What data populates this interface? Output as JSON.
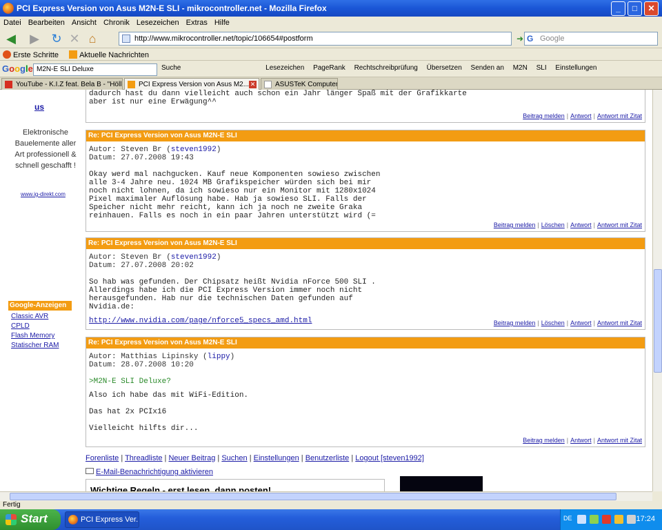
{
  "window": {
    "title": "PCI Express Version von Asus M2N-E SLI - mikrocontroller.net - Mozilla Firefox",
    "minimize": "_",
    "maximize": "□",
    "close": "✕"
  },
  "menu": [
    "Datei",
    "Bearbeiten",
    "Ansicht",
    "Chronik",
    "Lesezeichen",
    "Extras",
    "Hilfe"
  ],
  "nav": {
    "back_icon": "back-arrow-icon",
    "url": "http://www.mikrocontroller.net/topic/106654#postform",
    "search_placeholder": "Google"
  },
  "bookmarks": [
    "Erste Schritte",
    "Aktuelle Nachrichten"
  ],
  "google_toolbar": {
    "logo": "Google",
    "query": "M2N-E SLI Deluxe",
    "items": [
      "Suche",
      "Lesezeichen",
      "PageRank",
      "Rechtschreibprüfung",
      "Übersetzen",
      "Senden an",
      "M2N",
      "SLI",
      "Einstellungen"
    ]
  },
  "tabs": [
    {
      "label": "YouTube - K.I.Z feat. Bela B - \"Hölle\"...",
      "active": false
    },
    {
      "label": "PCI Express Version von Asus M2...",
      "active": true
    },
    {
      "label": "ASUSTeK Computer Inc.",
      "active": false
    }
  ],
  "sidebar": {
    "us_link": "us",
    "ad_text": "Elektronische Bauelemente aller Art professionell & schnell geschafft !",
    "ad_link": "www.ig-direkt.com",
    "google_ads_heading": "Google-Anzeigen",
    "google_ads": [
      "Classic AVR",
      "CPLD",
      "Flash Memory",
      "Statischer RAM"
    ]
  },
  "prev_post": {
    "body": "dadurch hast du dann vielleicht auch schon ein Jahr länger Spaß mit der Grafikkarte\naber ist nur eine Erwägung^^",
    "actions": [
      "Beitrag melden",
      "Antwort",
      "Antwort mit Zitat"
    ]
  },
  "posts": [
    {
      "title": "Re: PCI Express Version von Asus M2N-E SLI",
      "author_label": "Autor: Steven Br",
      "author_nick": "steven1992",
      "date": "Datum: 27.07.2008 19:43",
      "body": "Okay werd mal nachgucken. Kauf neue Komponenten sowieso zwischen alle 3-4 Jahre neu. 1024 MB Grafikspeicher würden sich bei mir noch nicht lohnen, da ich sowieso nur ein Monitor mit 1280x1024 Pixel maximaler Auflösung habe. Hab ja sowieso SLI. Falls der Speicher nicht mehr reicht, kann ich ja noch ne zweite Graka reinhauen. Falls es noch in ein paar Jahren unterstützt wird (=",
      "actions": [
        "Beitrag melden",
        "Löschen",
        "Antwort",
        "Antwort mit Zitat"
      ]
    },
    {
      "title": "Re: PCI Express Version von Asus M2N-E SLI",
      "author_label": "Autor: Steven Br",
      "author_nick": "steven1992",
      "date": "Datum: 27.07.2008 20:02",
      "body": "So hab was gefunden. Der Chipsatz heißt Nvidia nForce 500 SLI . Allerdings habe ich die PCI Express Version immer noch nicht herausgefunden. Hab nur die technischen Daten gefunden auf Nvidia.de:",
      "link": "http://www.nvidia.com/page/nforce5_specs_amd.html",
      "actions": [
        "Beitrag melden",
        "Löschen",
        "Antwort",
        "Antwort mit Zitat"
      ]
    },
    {
      "title": "Re: PCI Express Version von Asus M2N-E SLI",
      "author_label": "Autor: Matthias Lipinsky",
      "author_nick": "lippy",
      "date": "Datum: 28.07.2008 10:20",
      "quote": ">M2N-E SLI Deluxe?",
      "body": "Also ich habe das mit WiFi-Edition.\n\nDas hat 2x PCIx16\n\nVielleicht hilfts dir...",
      "actions": [
        "Beitrag melden",
        "Antwort",
        "Antwort mit Zitat"
      ]
    }
  ],
  "footer": {
    "links": [
      "Forenliste",
      "Threadliste",
      "Neuer Beitrag",
      "Suchen",
      "Einstellungen",
      "Benutzerliste",
      "Logout [steven1992]"
    ],
    "mail": "E-Mail-Benachrichtigung aktivieren",
    "rules_heading": "Wichtige Regeln - erst lesen, dann posten!"
  },
  "status": "Fertig",
  "taskbar": {
    "start": "Start",
    "task": "PCI Express Ver...",
    "lang": "DE",
    "clock": "17:24"
  },
  "colors": {
    "post_header": "#f39c12",
    "link": "#1a1aa6",
    "titlebar": "#1a56d6"
  }
}
